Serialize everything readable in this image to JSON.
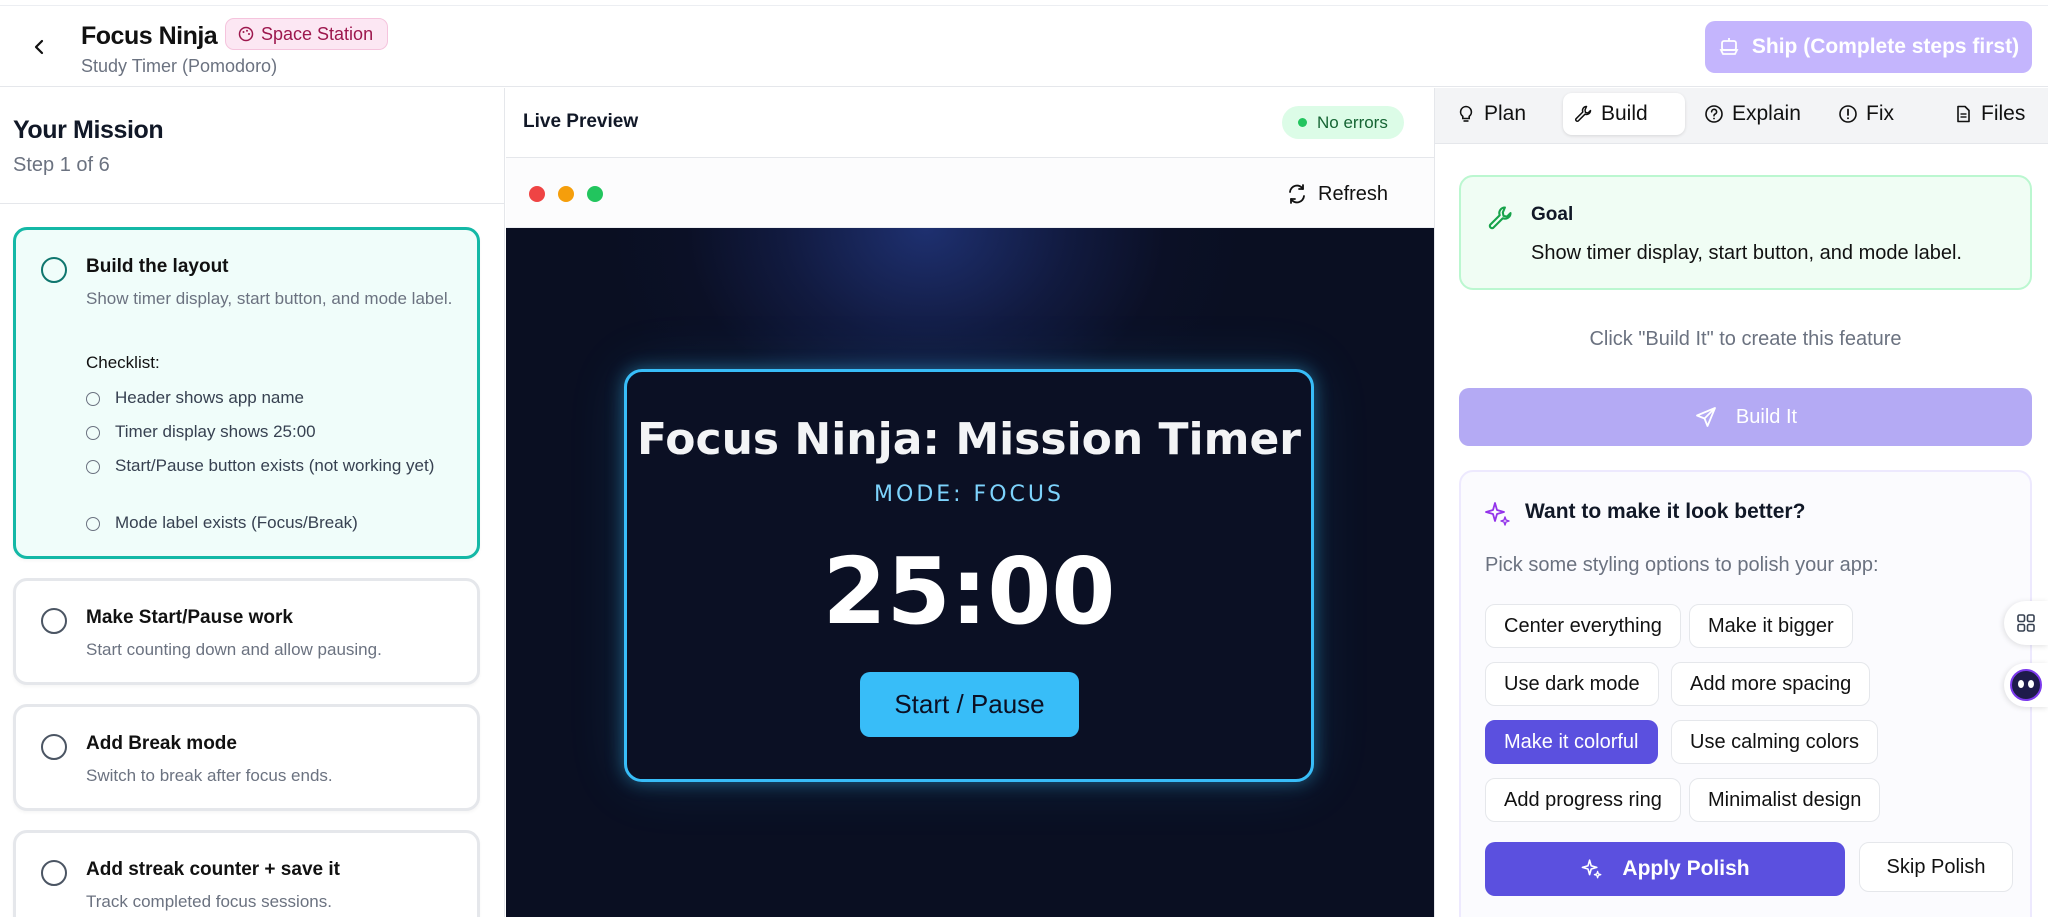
{
  "header": {
    "app_title": "Focus Ninja",
    "theme_badge": "Space Station",
    "subtitle": "Study Timer (Pomodoro)",
    "ship_label": "Ship (Complete steps first)"
  },
  "mission": {
    "title": "Your Mission",
    "step_indicator": "Step 1 of 6",
    "steps": [
      {
        "title": "Build the layout",
        "desc": "Show timer display, start button, and mode label.",
        "checklist_label": "Checklist:",
        "checklist": [
          "Header shows app name",
          "Timer display shows 25:00",
          "Start/Pause button exists (not working yet)",
          "Mode label exists (Focus/Break)"
        ]
      },
      {
        "title": "Make Start/Pause work",
        "desc": "Start counting down and allow pausing."
      },
      {
        "title": "Add Break mode",
        "desc": "Switch to break after focus ends."
      },
      {
        "title": "Add streak counter + save it",
        "desc": "Track completed focus sessions."
      }
    ]
  },
  "preview": {
    "title": "Live Preview",
    "status": "No errors",
    "refresh_label": "Refresh",
    "app": {
      "title": "Focus Ninja: Mission Timer",
      "mode": "MODE: FOCUS",
      "timer": "25:00",
      "button": "Start / Pause"
    }
  },
  "panel": {
    "tabs": [
      {
        "label": "Plan",
        "icon": "lightbulb-icon"
      },
      {
        "label": "Build",
        "icon": "wrench-icon"
      },
      {
        "label": "Explain",
        "icon": "question-icon"
      },
      {
        "label": "Fix",
        "icon": "alert-icon"
      },
      {
        "label": "Files",
        "icon": "file-icon"
      }
    ],
    "goal": {
      "label": "Goal",
      "text": "Show timer display, start button, and mode label."
    },
    "hint": "Click \"Build It\" to create this feature",
    "build_label": "Build It",
    "polish": {
      "title": "Want to make it look better?",
      "subtitle": "Pick some styling options to polish your app:",
      "options": [
        "Center everything",
        "Make it bigger",
        "Use dark mode",
        "Add more spacing",
        "Make it colorful",
        "Use calming colors",
        "Add progress ring",
        "Minimalist design"
      ],
      "selected": "Make it colorful",
      "apply_label": "Apply Polish",
      "skip_label": "Skip Polish"
    }
  },
  "colors": {
    "accent": "#5b50df",
    "active_step": "#14b8a6",
    "timer_glow": "#38bdf8",
    "badge_bg": "#fce7f3"
  }
}
